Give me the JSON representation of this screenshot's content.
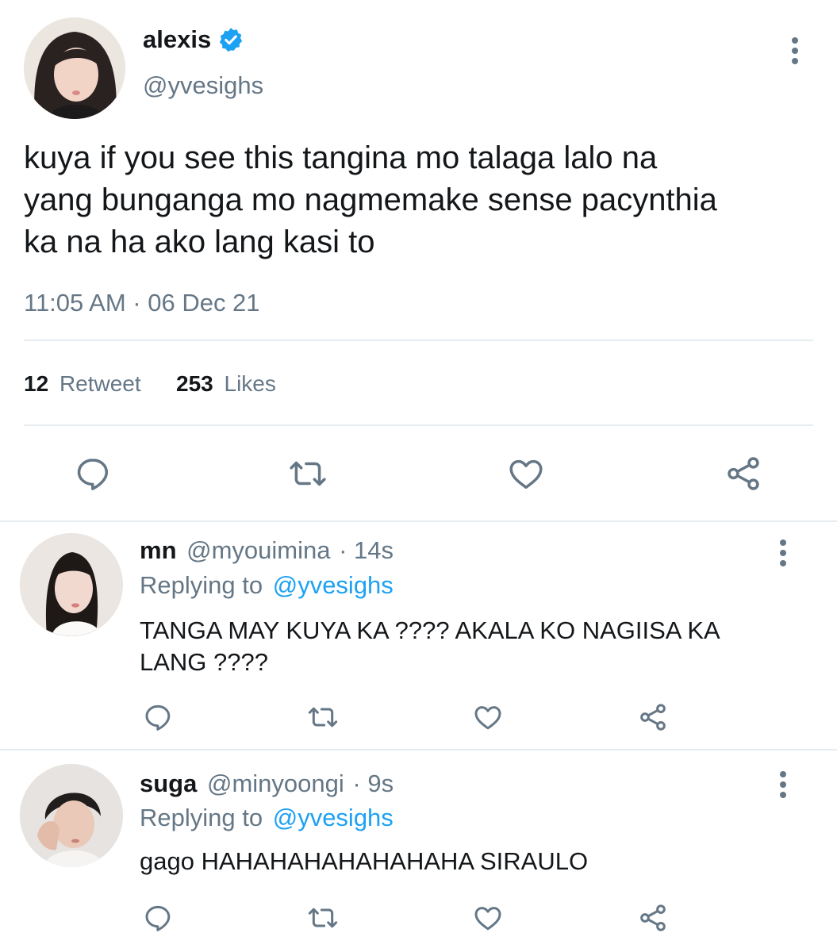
{
  "tweet": {
    "author": {
      "name": "alexis",
      "handle": "@yvesighs",
      "verified": true
    },
    "text_lines": [
      "kuya if you see this tangina mo talaga lalo na",
      "yang bunganga mo nagmemake sense pacynthia",
      "ka na ha ako lang kasi to"
    ],
    "timestamp": "11:05 AM · 06 Dec 21",
    "stats": {
      "retweets_count": "12",
      "retweets_label": "Retweet",
      "likes_count": "253",
      "likes_label": "Likes"
    },
    "actions": [
      "reply-icon",
      "retweet-icon",
      "like-icon",
      "share-icon"
    ]
  },
  "replies": [
    {
      "name": "mn",
      "handle": "@myouimina",
      "time": "· 14s",
      "replying_prefix": "Replying to",
      "replying_to": "@yvesighs",
      "text_lines": [
        "TANGA MAY KUYA KA ???? AKALA KO NAGIISA KA",
        "LANG ????"
      ]
    },
    {
      "name": "suga",
      "handle": "@minyoongi",
      "time": "· 9s",
      "replying_prefix": "Replying to",
      "replying_to": "@yvesighs",
      "text_lines": [
        "gago HAHAHAHAHAHAHAHA SIRAULO"
      ]
    }
  ],
  "colors": {
    "text": "#14171a",
    "secondary": "#657786",
    "accent": "#1da1f2",
    "divider": "#e6ecf0"
  }
}
